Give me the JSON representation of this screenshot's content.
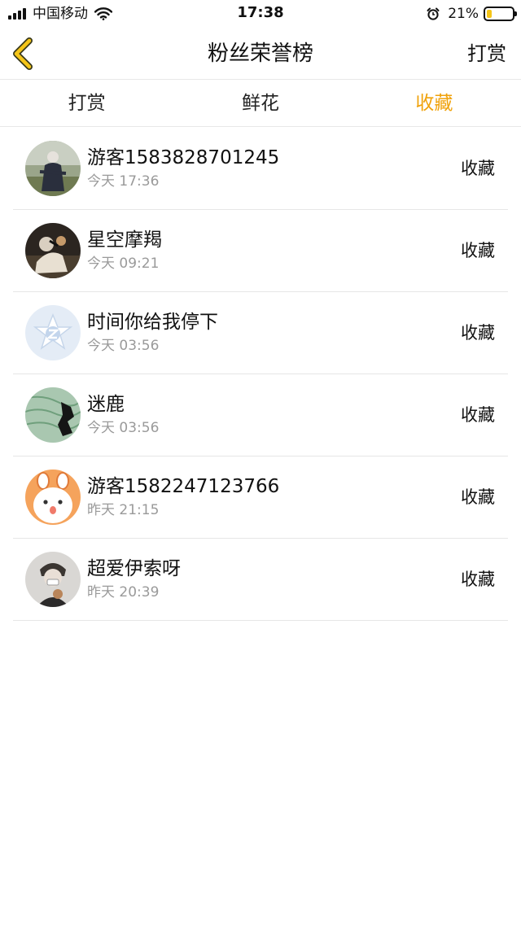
{
  "status_bar": {
    "carrier": "中国移动",
    "time": "17:38",
    "battery_percent": "21%",
    "battery_level": 0.21,
    "signal_icon": "signal-icon",
    "wifi_icon": "wifi-icon",
    "alarm_icon": "alarm-icon"
  },
  "nav": {
    "back_icon": "chevron-left-icon",
    "title": "粉丝荣誉榜",
    "right_label": "打赏"
  },
  "tabs": [
    {
      "label": "打赏",
      "active": false
    },
    {
      "label": "鲜花",
      "active": false
    },
    {
      "label": "收藏",
      "active": true
    }
  ],
  "colors": {
    "accent": "#f0a20b",
    "back_arrow": "#f5c518",
    "secondary_text": "#9a9a9a"
  },
  "fans": [
    {
      "name": "游客1583828701245",
      "time": "今天 17:36",
      "action": "收藏"
    },
    {
      "name": "星空摩羯",
      "time": "今天 09:21",
      "action": "收藏"
    },
    {
      "name": "时间你给我停下",
      "time": "今天 03:56",
      "action": "收藏"
    },
    {
      "name": "迷鹿",
      "time": "今天 03:56",
      "action": "收藏"
    },
    {
      "name": "游客1582247123766",
      "time": "昨天 21:15",
      "action": "收藏"
    },
    {
      "name": "超爱伊索呀",
      "time": "昨天 20:39",
      "action": "收藏"
    }
  ]
}
